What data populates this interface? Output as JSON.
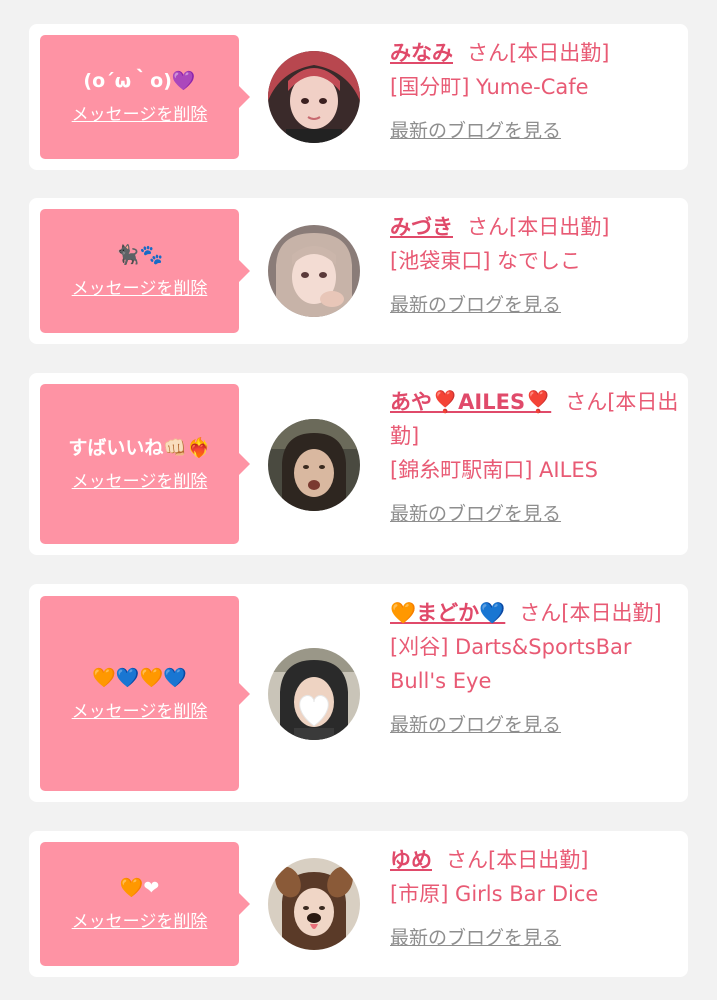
{
  "delete_label": "メッセージを削除",
  "blog_label": "最新のブログを見る",
  "cards": [
    {
      "message": "(o´ω｀o)💜",
      "name": "みなみ",
      "status": "さん[本日出勤]",
      "shop": "[国分町] Yume-Cafe",
      "avatar": "photo-woman-pink-hair"
    },
    {
      "message": "🐈‍⬛🐾",
      "name": "みづき",
      "status": "さん[本日出勤]",
      "shop": "[池袋東口] なでしこ",
      "avatar": "photo-woman-light-hair"
    },
    {
      "message": "すばいいね👊🏻❤️‍🔥",
      "name": "あや❣️AILES❣️",
      "status": "さん[本日出勤]",
      "shop": "[錦糸町駅南口] AILES",
      "avatar": "photo-woman-dark-room"
    },
    {
      "message": "🧡💙🧡💙",
      "name": "🧡まどか💙",
      "status": "さん[本日出勤]",
      "shop": "[刈谷] Darts&SportsBar Bull's Eye",
      "avatar": "photo-woman-heart-sticker"
    },
    {
      "message": "🧡❤",
      "name": "ゆめ",
      "status": "さん[本日出勤]",
      "shop": "[市原] Girls Bar Dice",
      "avatar": "photo-woman-dog-filter"
    }
  ],
  "colors": {
    "bubble": "#fe93a4",
    "name": "#e04a6a",
    "text": "#e85a74",
    "link_gray": "#8e8e8e",
    "background": "#f2f2f2"
  }
}
